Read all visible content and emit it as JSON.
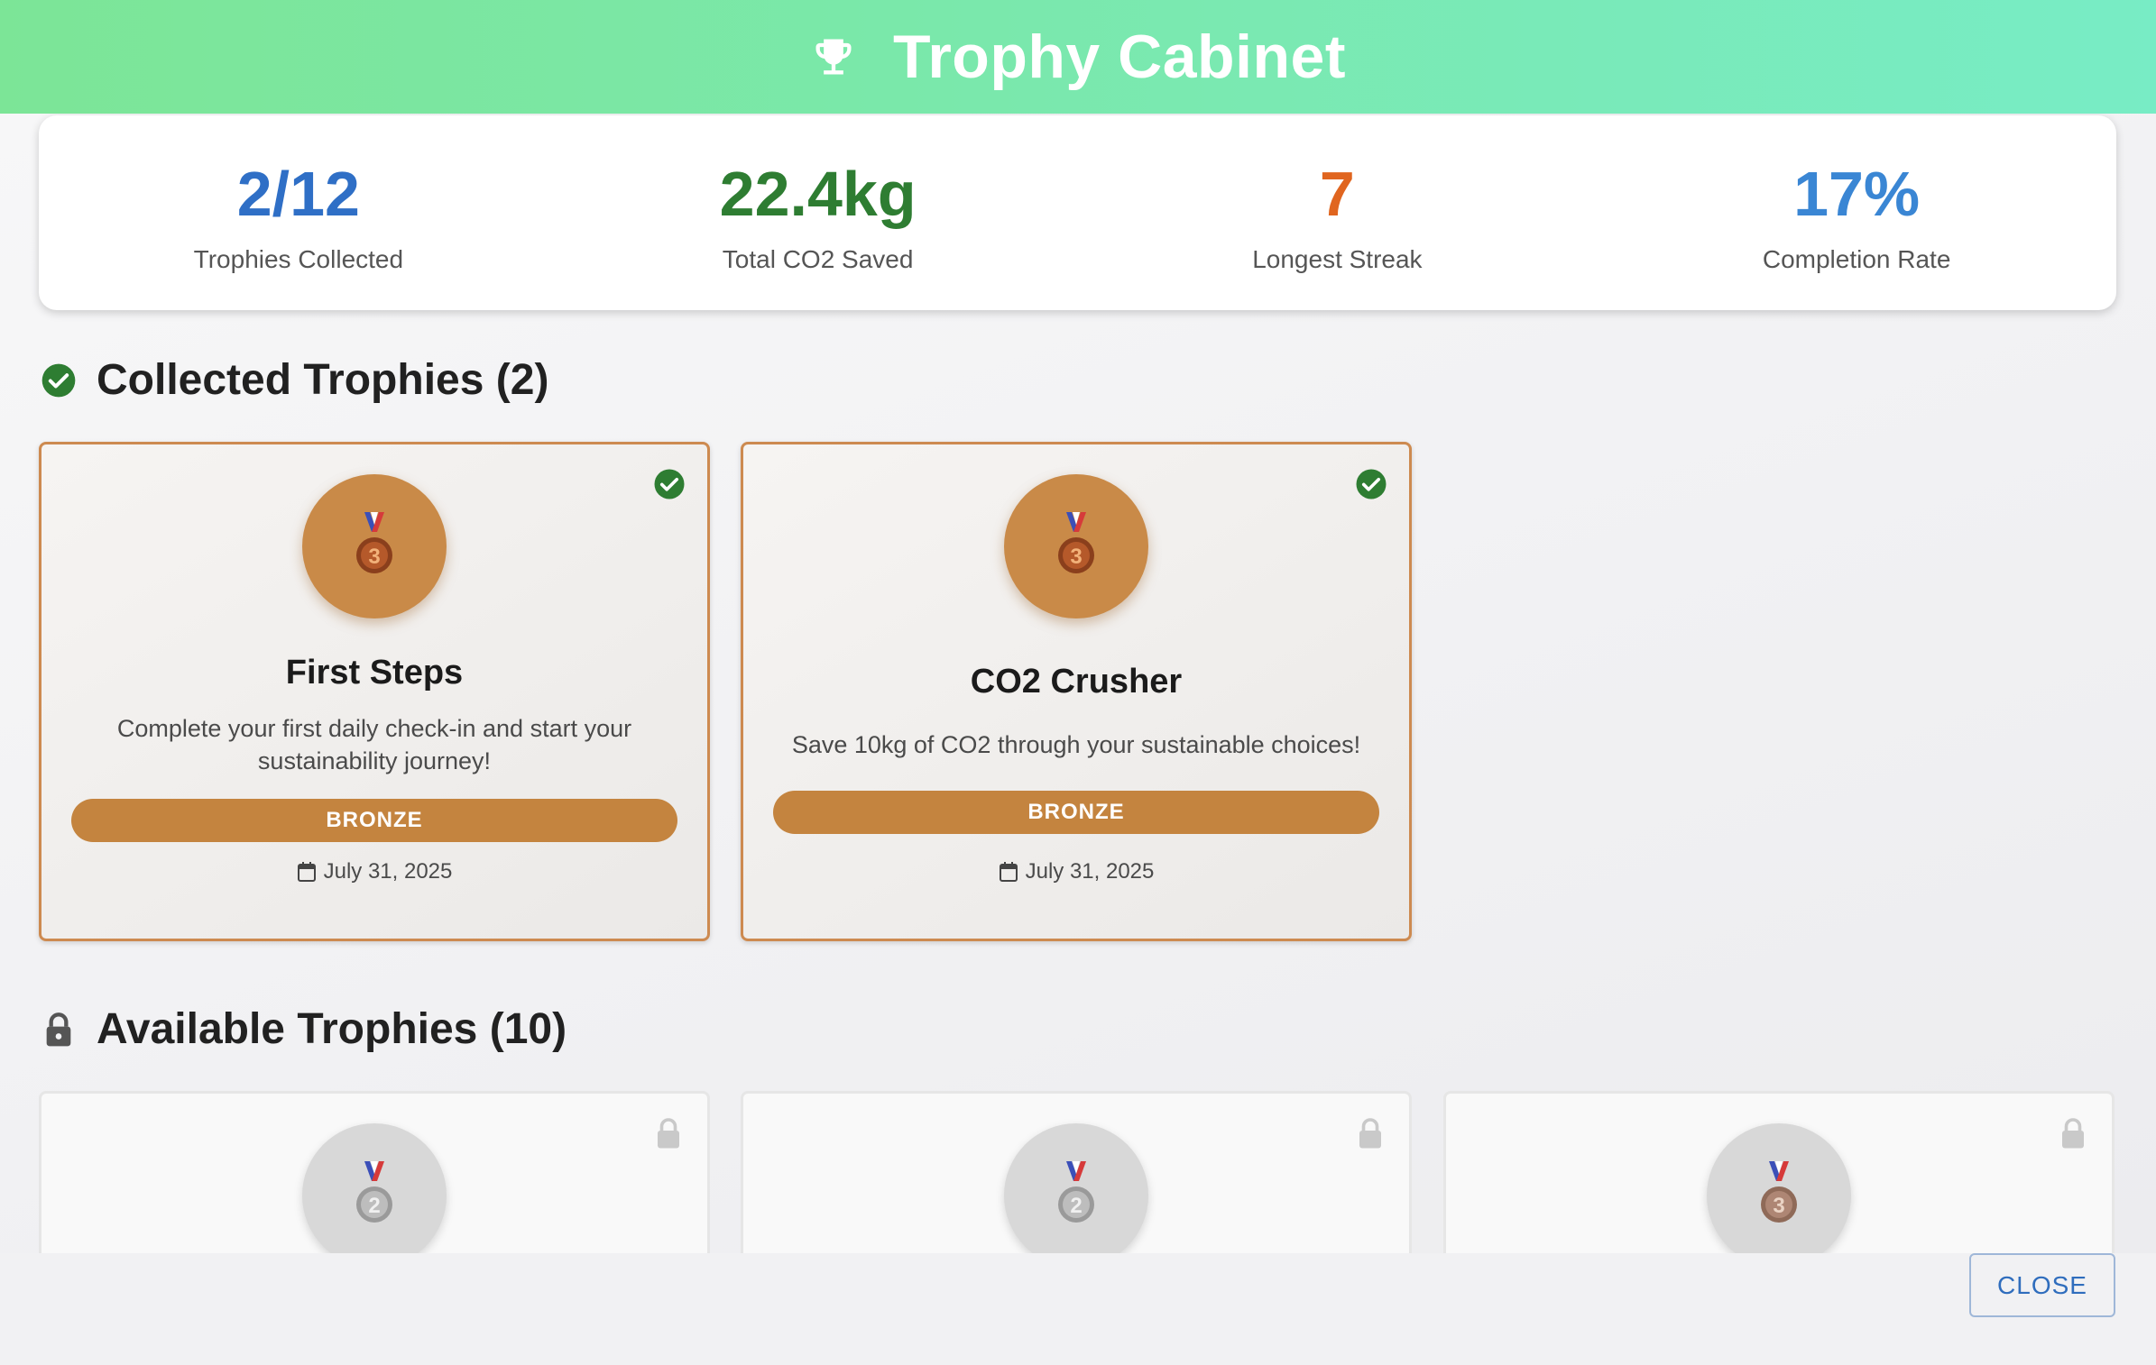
{
  "header": {
    "title": "Trophy Cabinet",
    "icon": "trophy-icon"
  },
  "stats": [
    {
      "value": "2/12",
      "label": "Trophies Collected",
      "color": "#2f6fc6"
    },
    {
      "value": "22.4kg",
      "label": "Total CO2 Saved",
      "color": "#2e7d32"
    },
    {
      "value": "7",
      "label": "Longest Streak",
      "color": "#e0651f"
    },
    {
      "value": "17%",
      "label": "Completion Rate",
      "color": "#3a86d4"
    }
  ],
  "collected": {
    "title": "Collected Trophies (2)",
    "icon": "check-circle-icon",
    "cards": [
      {
        "title": "First Steps",
        "description": "Complete your first daily check-in and start your sustainability journey!",
        "tier": "BRONZE",
        "date": "July 31, 2025",
        "medal": "3"
      },
      {
        "title": "CO2 Crusher",
        "description": "Save 10kg of CO2 through your sustainable choices!",
        "tier": "BRONZE",
        "date": "July 31, 2025",
        "medal": "3"
      }
    ]
  },
  "available": {
    "title": "Available Trophies (10)",
    "icon": "lock-icon",
    "cards": [
      {
        "medal": "2"
      },
      {
        "medal": "2"
      },
      {
        "medal": "3"
      }
    ]
  },
  "footer": {
    "close_label": "CLOSE"
  },
  "colors": {
    "accent_green": "#2e7d32",
    "bronze": "#c4843f",
    "header_from": "#7ce597",
    "header_to": "#78ecc5"
  }
}
